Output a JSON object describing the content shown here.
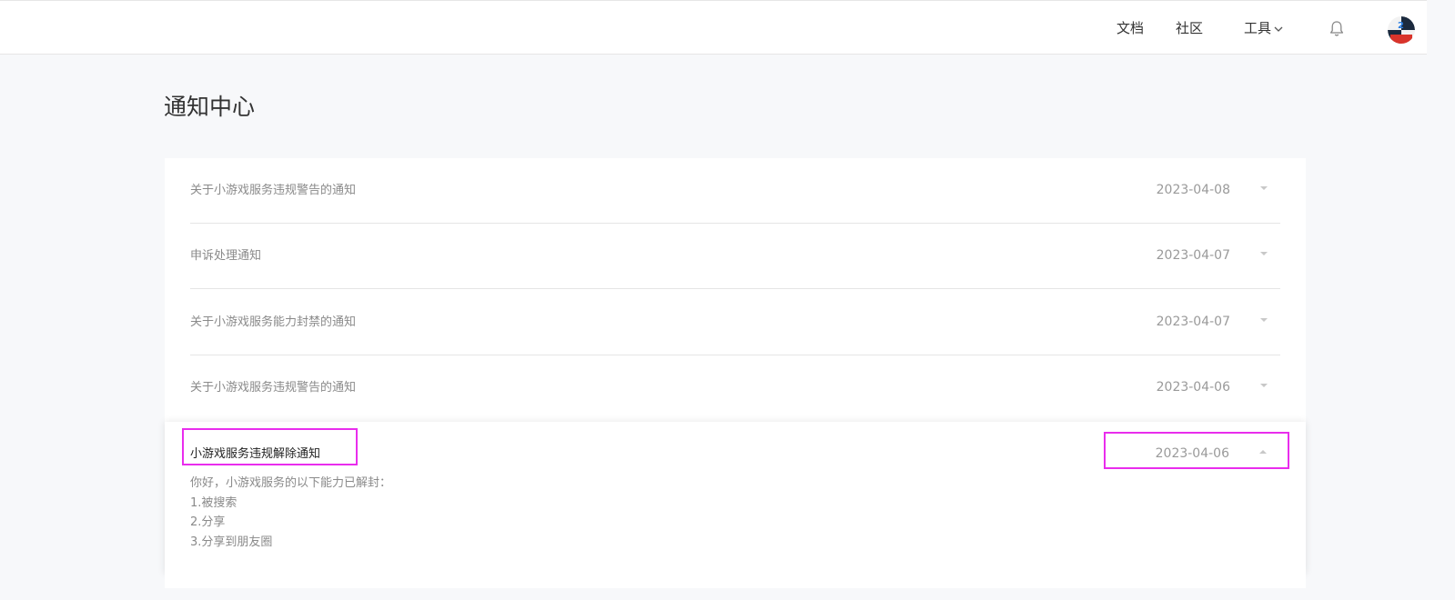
{
  "header": {
    "nav": [
      {
        "label": "文档"
      },
      {
        "label": "社区"
      },
      {
        "label": "工具"
      }
    ]
  },
  "page": {
    "title": "通知中心"
  },
  "notifications": [
    {
      "title": "关于小游戏服务违规警告的通知",
      "date": "2023-04-08"
    },
    {
      "title": "申诉处理通知",
      "date": "2023-04-07"
    },
    {
      "title": "关于小游戏服务能力封禁的通知",
      "date": "2023-04-07"
    },
    {
      "title": "关于小游戏服务违规警告的通知",
      "date": "2023-04-06"
    }
  ],
  "expanded": {
    "title": "小游戏服务违规解除通知",
    "date": "2023-04-06",
    "body": [
      "你好，小游戏服务的以下能力已解封：",
      "1.被搜索",
      "2.分享",
      "3.分享到朋友圈"
    ]
  },
  "icons": {
    "bell": "bell-icon",
    "tools_dropdown": "chevron-down-icon",
    "row_toggle": "caret-down-icon",
    "expanded_toggle": "caret-up-icon"
  },
  "colors": {
    "highlight": "#e92ded",
    "background": "#f7f8fa"
  }
}
